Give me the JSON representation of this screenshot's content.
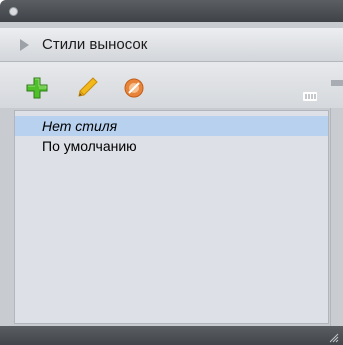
{
  "panel": {
    "title": "Стили выносок"
  },
  "toolbar": {
    "add_icon": "plus-icon",
    "edit_icon": "pencil-icon",
    "delete_icon": "delete-style-icon"
  },
  "styles_list": {
    "items": [
      {
        "label": "Нет стиля",
        "selected": true
      },
      {
        "label": "По умолчанию",
        "selected": false
      }
    ]
  },
  "colors": {
    "selection": "#b8d1ee",
    "add_green": "#4fbf2a",
    "pencil_yellow": "#f2b91a",
    "delete_orange": "#e8843a"
  }
}
